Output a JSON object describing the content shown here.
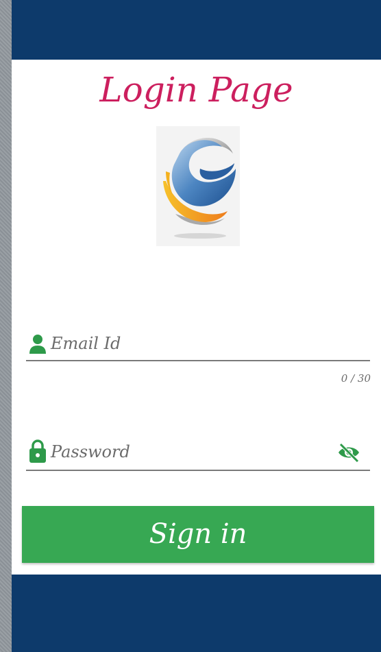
{
  "header": {
    "title": "Login Page"
  },
  "logo": {
    "icon": "globe-logo-icon"
  },
  "email": {
    "placeholder": "Email Id",
    "counter": "0 / 30",
    "icon": "person-icon"
  },
  "password": {
    "placeholder": "Password",
    "icon": "lock-icon",
    "toggle_icon": "eye-off-icon"
  },
  "signin": {
    "label": "Sign in"
  },
  "colors": {
    "bar": "#0d3a6b",
    "title": "#cc1f5e",
    "accent_green": "#37a853",
    "icon_green": "#2e9a4a"
  }
}
